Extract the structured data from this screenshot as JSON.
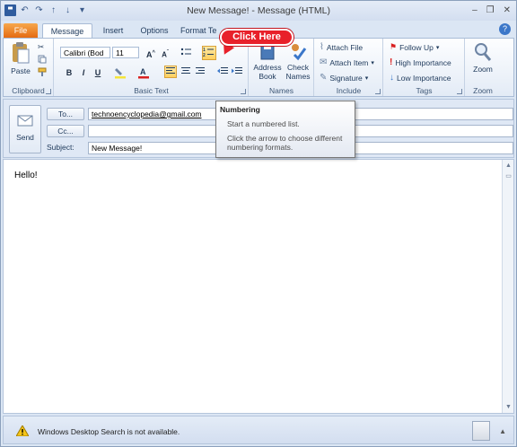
{
  "window": {
    "title": "New Message!  -  Message (HTML)",
    "controls": [
      "–",
      "❐",
      "✕"
    ]
  },
  "tabs": [
    {
      "label": "File"
    },
    {
      "label": "Message"
    },
    {
      "label": "Insert"
    },
    {
      "label": "Options"
    },
    {
      "label": "Format Te"
    }
  ],
  "ribbon": {
    "clipboard": {
      "label": "Clipboard",
      "paste_label": "Paste"
    },
    "basic_text": {
      "label": "Basic Text",
      "font_name": "Calibri (Bod",
      "font_size": "11"
    },
    "names": {
      "label": "Names",
      "address_book_label": "Address\nBook",
      "check_names_label": "Check\nNames"
    },
    "include": {
      "label": "Include",
      "attach_file": "Attach File",
      "attach_item": "Attach Item",
      "signature": "Signature"
    },
    "tags": {
      "label": "Tags",
      "follow_up": "Follow Up",
      "high_importance": "High Importance",
      "low_importance": "Low Importance"
    },
    "zoom": {
      "label": "Zoom",
      "zoom_label": "Zoom"
    }
  },
  "callout": {
    "text": "Click Here"
  },
  "tooltip": {
    "title": "Numbering",
    "line1": "Start a numbered list.",
    "line2": "Click the arrow to choose different",
    "line3": "numbering formats."
  },
  "header": {
    "send_label": "Send",
    "to_label": "To...",
    "to_value": "technoencyclopedia@gmail.com",
    "cc_label": "Cc...",
    "cc_value": "",
    "subject_label": "Subject:",
    "subject_value": "New Message!"
  },
  "body": {
    "text": "Hello!"
  },
  "status": {
    "message": "Windows Desktop Search is not available."
  },
  "colors": {
    "accent": "#e46b12",
    "callout": "#e8202a",
    "ribbon_text": "#1e395b"
  }
}
